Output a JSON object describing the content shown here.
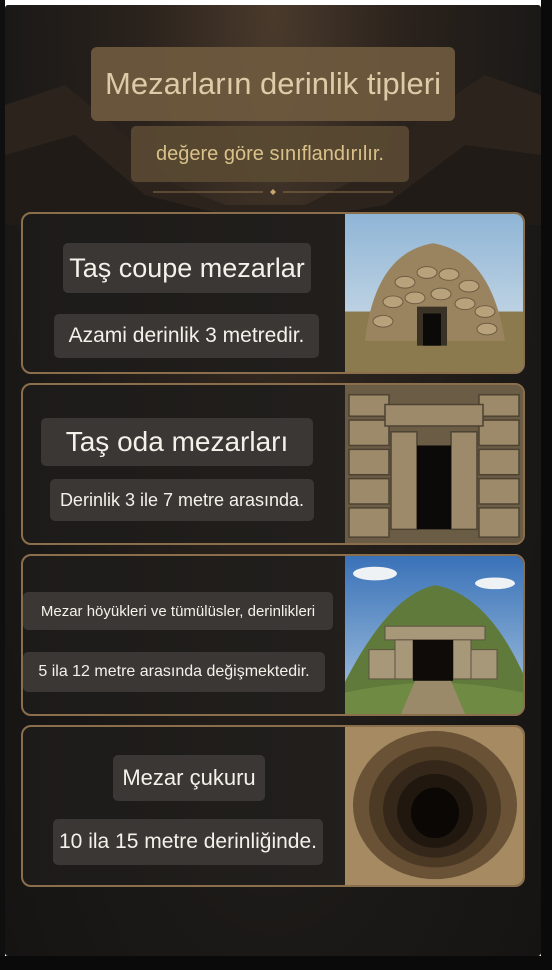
{
  "title": "Mezarların derinlik tipleri",
  "subtitle": "değere göre sınıflandırılır.",
  "cards": [
    {
      "heading": "Taş coupe mezarlar",
      "text": "Azami derinlik 3 metredir.",
      "image": "stone-beehive-tomb"
    },
    {
      "heading": "Taş oda mezarları",
      "text": "Derinlik 3 ile 7 metre arasında.",
      "image": "stone-chamber-entrance"
    },
    {
      "heading": "Mezar höyükleri ve tümülüsler, derinlikleri",
      "text": "5 ila 12 metre arasında değişmektedir.",
      "image": "grass-mound-tumulus"
    },
    {
      "heading": "Mezar çukuru",
      "text": "10 ila 15 metre derinliğinde.",
      "image": "deep-pit-shaft"
    }
  ],
  "colors": {
    "background": "#1b1917",
    "gold": "#8b6f4c",
    "title_bg": "#6e5a3e",
    "title_text": "#ecd9b4"
  }
}
